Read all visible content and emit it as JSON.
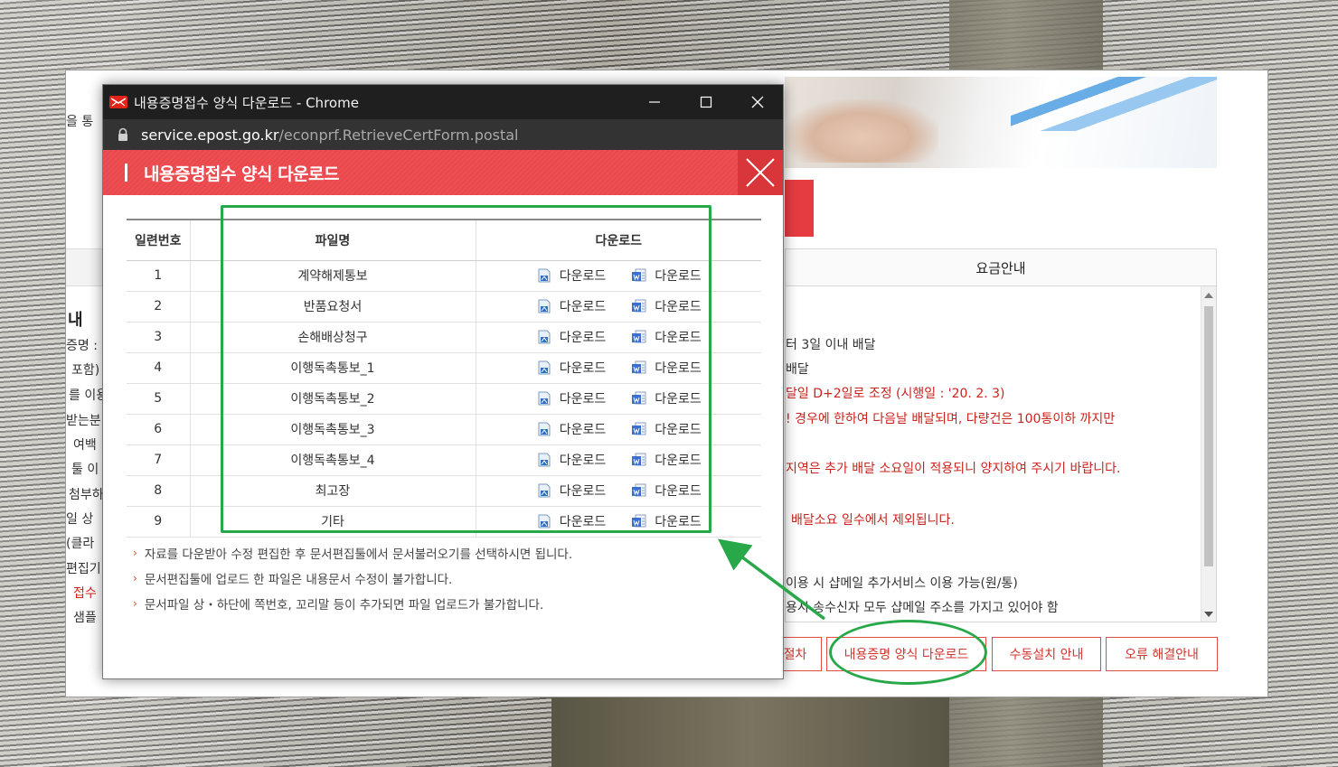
{
  "window": {
    "title": "내용증명접수 양식 다운로드 - Chrome",
    "url_host": "service.epost.go.kr",
    "url_path": "/econprf.RetrieveCertForm.postal"
  },
  "popup": {
    "header_title": "내용증명접수 양식 다운로드",
    "columns": {
      "no": "일련번호",
      "file": "파일명",
      "download": "다운로드"
    },
    "rows": [
      {
        "no": "1",
        "file": "계약해제통보",
        "dl1": "다운로드",
        "dl2": "다운로드"
      },
      {
        "no": "2",
        "file": "반품요청서",
        "dl1": "다운로드",
        "dl2": "다운로드"
      },
      {
        "no": "3",
        "file": "손해배상청구",
        "dl1": "다운로드",
        "dl2": "다운로드"
      },
      {
        "no": "4",
        "file": "이행독촉통보_1",
        "dl1": "다운로드",
        "dl2": "다운로드"
      },
      {
        "no": "5",
        "file": "이행독촉통보_2",
        "dl1": "다운로드",
        "dl2": "다운로드"
      },
      {
        "no": "6",
        "file": "이행독촉통보_3",
        "dl1": "다운로드",
        "dl2": "다운로드"
      },
      {
        "no": "7",
        "file": "이행독촉통보_4",
        "dl1": "다운로드",
        "dl2": "다운로드"
      },
      {
        "no": "8",
        "file": "최고장",
        "dl1": "다운로드",
        "dl2": "다운로드"
      },
      {
        "no": "9",
        "file": "기타",
        "dl1": "다운로드",
        "dl2": "다운로드"
      }
    ],
    "notes": [
      "자료를 다운받아 수정 편집한 후 문서편집툴에서 문서불러오기를 선택하시면 됩니다.",
      "문서편집툴에 업로드 한 파일은 내용문서 수정이 불가합니다.",
      "문서파일 상・하단에 쪽번호, 꼬리말 등이 추가되면 파일 업로드가 불가합니다."
    ]
  },
  "site": {
    "left_fragments": {
      "top": "을 통",
      "heading": "내",
      "lines": [
        "증명 :",
        "포함)",
        "를 이용",
        "받는분",
        "여백",
        "툴 이",
        "첨부하",
        "일 상",
        "(클라",
        "편집기 이"
      ],
      "red_line": "접수",
      "last_line": "샘플"
    },
    "fee_tab": "요금안내",
    "fee_lines": [
      {
        "text": "터 3일 이내 배달",
        "red": false
      },
      {
        "text": "배달",
        "red": false
      },
      {
        "text": "달일 D+2일로 조정 (시행일 : '20. 2. 3)",
        "red": true
      },
      {
        "text": "! 경우에 한하여 다음날 배달되며, 다량건은 100통이하 까지만",
        "red": true
      },
      {
        "text": "지역은 추가 배달 소요일이 적용되니 양지하여 주시기 바랍니다.",
        "red": true
      },
      {
        "text": "배달소요 일수에서 제외됩니다.",
        "red": true
      },
      {
        "text": "이용 시 샵메일 추가서비스 이용 가능(원/통)",
        "red": false
      },
      {
        "text": "용시 송수신자 모두 샵메일 주소를 가지고 있어야 함",
        "red": false
      }
    ],
    "buttons": [
      "절차",
      "내용증명 양식 다운로드",
      "수동설치 안내",
      "오류 해결안내"
    ]
  },
  "colors": {
    "popup_header": "#e8474b",
    "highlight_green": "#28a849",
    "button_red": "#d2342d"
  },
  "icons": [
    "document-icon",
    "word-doc-icon",
    "lock-icon",
    "close-icon",
    "minimize-icon",
    "maximize-icon"
  ]
}
